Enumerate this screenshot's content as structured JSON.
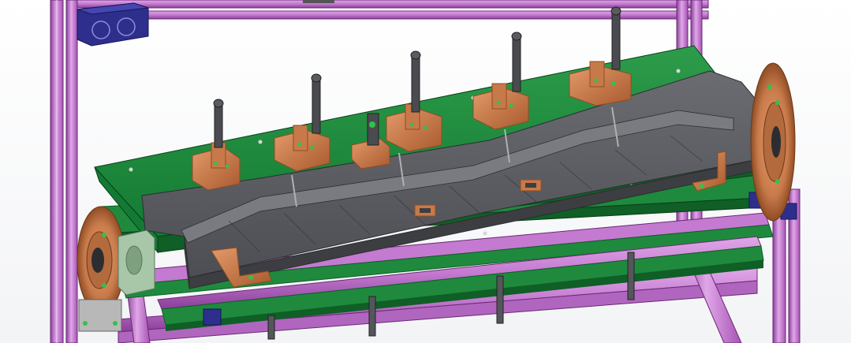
{
  "viewport": {
    "label": "",
    "colors": {
      "frame_purple": "#c47ad0",
      "frame_purple_dark": "#8b3f9a",
      "frame_purple_light": "#e0a7e8",
      "plate_green": "#1f8a3d",
      "plate_green_dark": "#0f5f26",
      "die_gray": "#5e5f64",
      "die_gray_dark": "#3d3e42",
      "die_gray_light": "#7a7b80",
      "bracket_copper": "#c7794a",
      "bracket_copper_dark": "#8f4d24",
      "clamp_dark": "#4a4b50",
      "block_blue": "#2e2f8c",
      "bearing_green": "#a7c7a8"
    },
    "components": [
      "frame-column-left",
      "frame-column-right",
      "frame-top-beam",
      "base-plate",
      "lower-plate",
      "die-body",
      "toggle-clamp",
      "rotary-disc-left",
      "rotary-disc-right",
      "pillow-block-bearing",
      "blue-connector-block"
    ],
    "clamp_count": 6,
    "icons": [
      "rotary-disc-icon",
      "toggle-clamp-icon",
      "bolt-icon"
    ]
  }
}
